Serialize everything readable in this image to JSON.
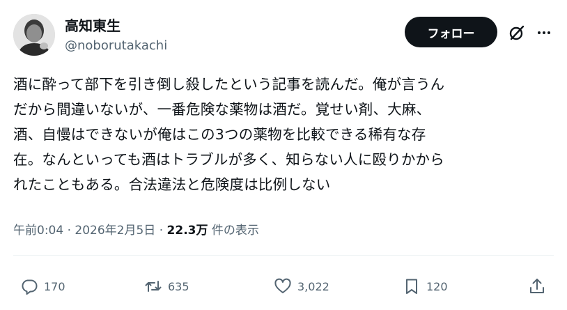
{
  "author": {
    "display_name": "高知東生",
    "handle": "@noborutakachi"
  },
  "header": {
    "follow_label": "フォロー"
  },
  "tweet": {
    "lines": [
      "酒に酔って部下を引き倒し殺したという記事を読んだ。俺が言うん",
      "だから間違いないが、一番危険な薬物は酒だ。覚せい剤、大麻、",
      "酒、自慢はできないが俺はこの3つの薬物を比較できる稀有な存",
      "在。なんといっても酒はトラブルが多く、知らない人に殴りかから",
      "れたこともある。合法違法と危険度は比例しない"
    ]
  },
  "meta": {
    "time": "午前0:04",
    "separator": "·",
    "date": "2026年2月5日",
    "views": "22.3万",
    "views_suffix": "件の表示"
  },
  "actions": {
    "replies": "170",
    "reposts": "635",
    "likes": "3,022",
    "bookmarks": "120"
  },
  "colors": {
    "text": "#0f1419",
    "secondary": "#536471",
    "button_bg": "#0f1419"
  },
  "icons": [
    "grok-icon",
    "more-icon",
    "reply-icon",
    "repost-icon",
    "like-icon",
    "bookmark-icon",
    "share-icon"
  ]
}
